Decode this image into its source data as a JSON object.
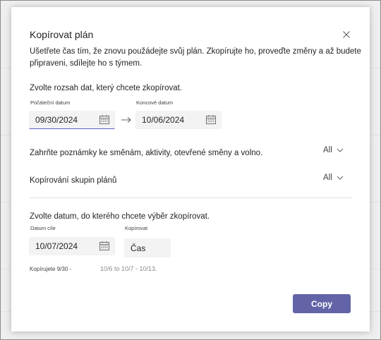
{
  "dialog": {
    "title": "Kopírovat plán",
    "description": "Ušetřete čas tím, že znovu použádejte svůj plán. Zkopírujte ho, proveďte změny a až budete připraveni, sdílejte ho s týmem.",
    "close_icon": "close-icon"
  },
  "range": {
    "label": "Zvolte rozsah dat, který chcete zkopírovat.",
    "start_label": "Počáteční datum",
    "start_value": "09/30/2024",
    "end_label": "Koncové datum",
    "end_value": "10/06/2024",
    "arrow_icon": "arrow-right-icon"
  },
  "options": {
    "notes_label": "Zahrňte poznámky ke směnám, aktivity, otevřené směny a volno.",
    "notes_value": "All",
    "groups_label": "Kopírování skupin plánů",
    "groups_value": "All"
  },
  "target": {
    "label": "Zvolte datum, do kterého chcete výběr zkopírovat.",
    "date_label": "Datum cíle",
    "date_value": "10/07/2024",
    "copy_label": "Kopírovat",
    "copy_value": "Čas"
  },
  "footer": {
    "summary_prefix": "Kopírujete 9/30 -",
    "summary_rest": "10/6 to 10/7 - 10/13."
  },
  "actions": {
    "copy_button": "Copy"
  },
  "colors": {
    "accent": "#6264a7",
    "focus_underline": "#5b5fc7"
  }
}
